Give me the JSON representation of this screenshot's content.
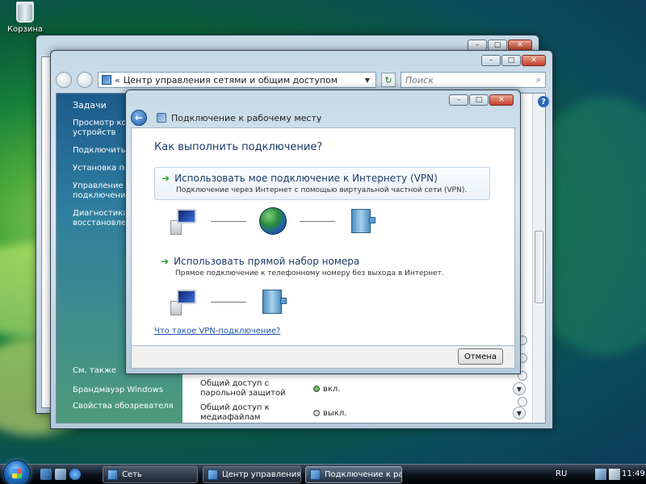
{
  "desktop": {
    "recycle_bin_label": "Корзина"
  },
  "control_panel": {
    "address": "Центр управления сетями и общим доступом",
    "search_placeholder": "Поиск",
    "left_pane": {
      "heading": "Задачи",
      "tasks": [
        "Просмотр ком… устройств",
        "Подключиться",
        "Установка подк… сети",
        "Управление се… подключениями",
        "Диагностика и … восстановлени…"
      ],
      "see_also": "См. также",
      "links": [
        "Брандмауэр Windows",
        "Свойства обозревателя"
      ]
    },
    "sharing": [
      {
        "label": "Общий доступ с парольной защитой",
        "state": "вкл."
      },
      {
        "label": "Общий доступ к медиафайлам",
        "state": "выкл."
      }
    ]
  },
  "dialog": {
    "title": "Подключение к рабочему месту",
    "question": "Как выполнить подключение?",
    "options": [
      {
        "title": "Использовать мое подключение к Интернету (VPN)",
        "description": "Подключение через Интернет с помощью виртуальной частной сети (VPN)."
      },
      {
        "title": "Использовать прямой набор номера",
        "description": "Прямое подключение к телефонному номеру без выхода в Интернет."
      }
    ],
    "help_link": "Что такое VPN-подключение?",
    "cancel_label": "Отмена"
  },
  "taskbar": {
    "items": [
      "Сеть",
      "Центр управления ...",
      "Подключение к ра..."
    ],
    "language": "RU",
    "time": "11:49"
  }
}
